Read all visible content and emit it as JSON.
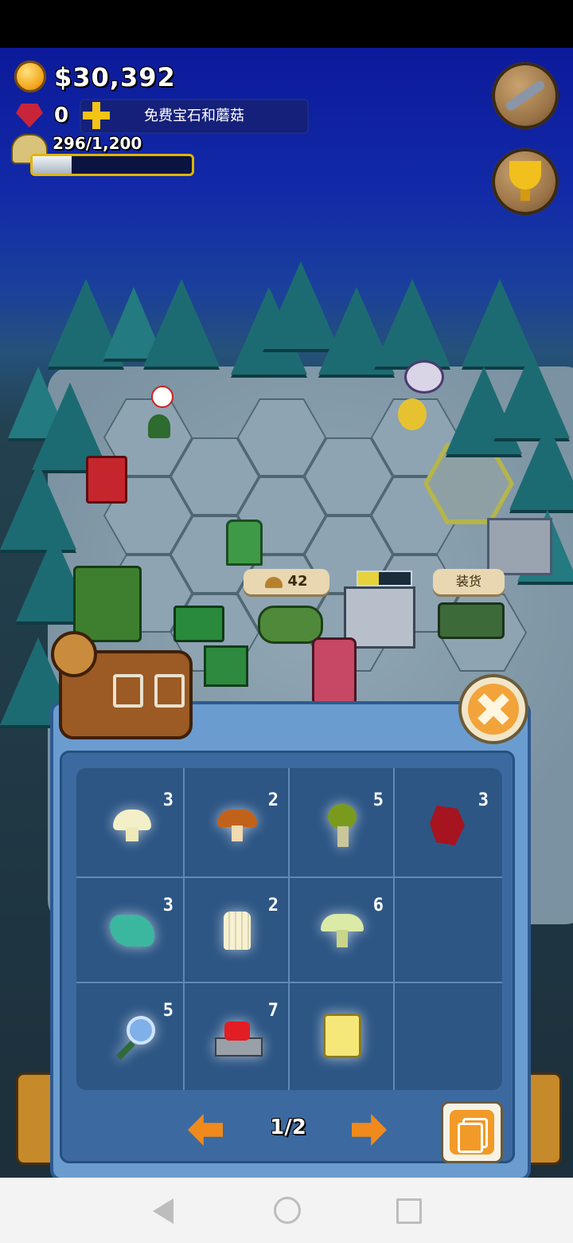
{
  "hud": {
    "money": "$30,392",
    "gems": "0",
    "free_banner": "免费宝石和蘑菇",
    "xp": "296/1,200",
    "xp_progress": 0.247
  },
  "map": {
    "mushroom_tag": "42",
    "load_tag": "装货"
  },
  "inventory": {
    "page": "1/2",
    "items": [
      {
        "icon": "white-mushroom-icon",
        "count": "3"
      },
      {
        "icon": "brown-mushroom-icon",
        "count": "2"
      },
      {
        "icon": "green-mushroom-icon",
        "count": "5"
      },
      {
        "icon": "red-gem-icon",
        "count": "3"
      },
      {
        "icon": "teal-mushroom-icon",
        "count": "3"
      },
      {
        "icon": "enoki-mushroom-icon",
        "count": "2"
      },
      {
        "icon": "pale-mushroom-icon",
        "count": "6"
      },
      {
        "icon": "",
        "count": ""
      },
      {
        "icon": "magnifier-icon",
        "count": "5"
      },
      {
        "icon": "red-button-icon",
        "count": "7"
      },
      {
        "icon": "jar-icon",
        "count": ""
      },
      {
        "icon": "",
        "count": ""
      }
    ]
  },
  "colors": {
    "sky_top": "#0c1a9a",
    "panel": "#6b9cd0",
    "accent_orange": "#f08a1c",
    "xp_border": "#e0b400"
  }
}
